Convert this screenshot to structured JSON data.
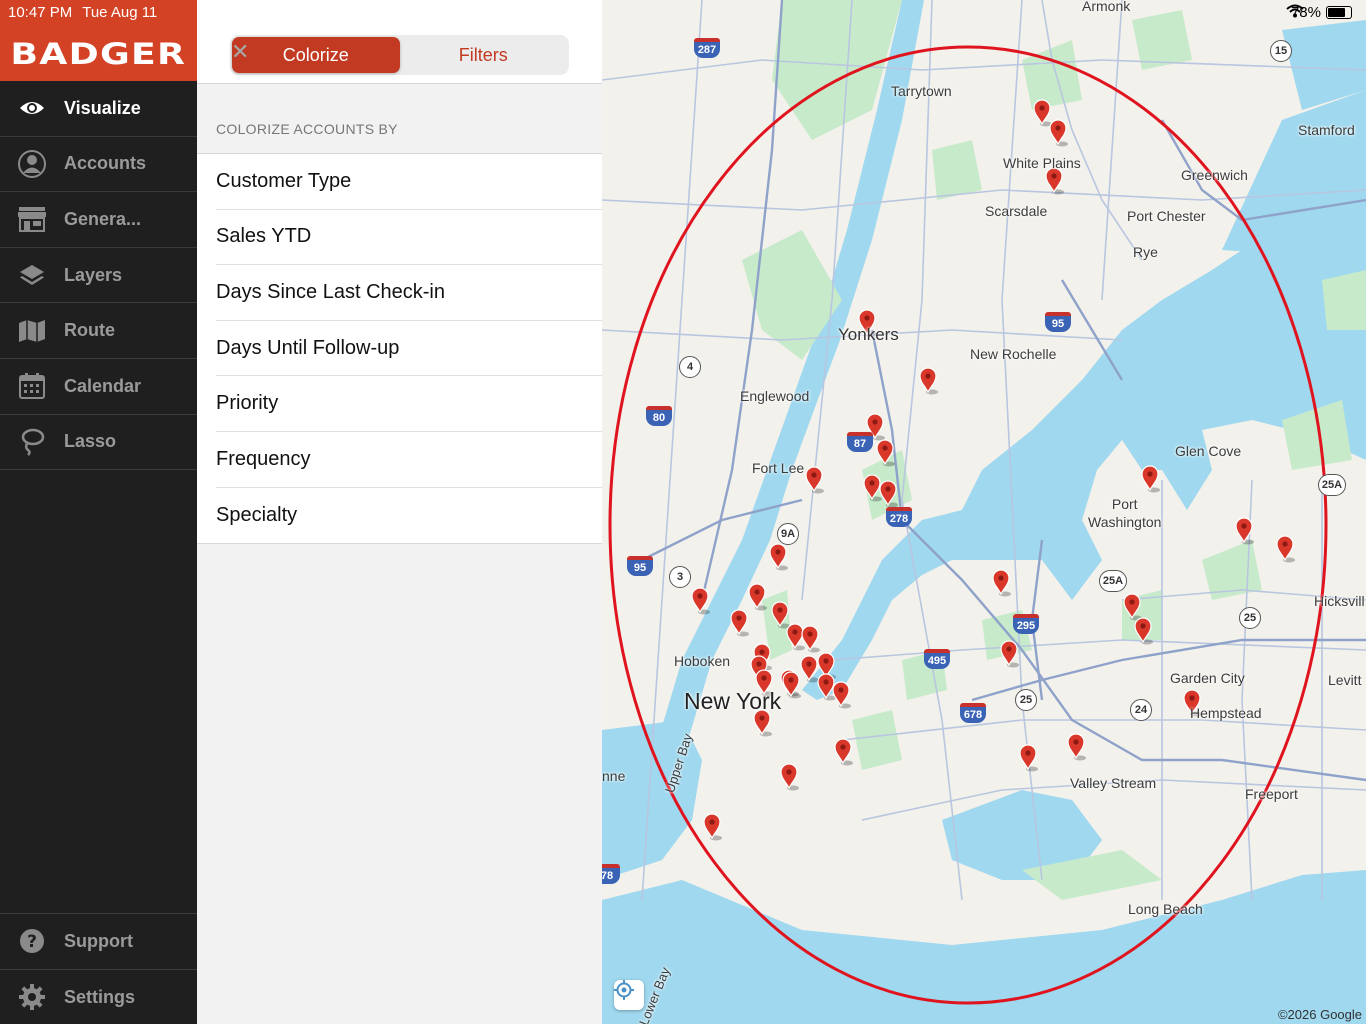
{
  "status": {
    "time": "10:47 PM",
    "date": "Tue Aug 11",
    "battery": "78%",
    "battery_level": 0.78
  },
  "brand": {
    "name": "BADGER",
    "color": "#d44226"
  },
  "sidebar": {
    "items": [
      {
        "label": "Visualize",
        "icon": "eye-icon",
        "active": true
      },
      {
        "label": "Accounts",
        "icon": "person-icon"
      },
      {
        "label": "Genera...",
        "icon": "storefront-icon"
      },
      {
        "label": "Layers",
        "icon": "layers-icon"
      },
      {
        "label": "Route",
        "icon": "map-icon"
      },
      {
        "label": "Calendar",
        "icon": "calendar-icon"
      },
      {
        "label": "Lasso",
        "icon": "lasso-icon"
      }
    ],
    "bottom_items": [
      {
        "label": "Support",
        "icon": "question-icon"
      },
      {
        "label": "Settings",
        "icon": "gear-icon"
      }
    ]
  },
  "panel": {
    "close_icon": "close-icon",
    "tabs": [
      {
        "label": "Colorize",
        "active": true
      },
      {
        "label": "Filters",
        "active": false
      }
    ],
    "section_title": "COLORIZE ACCOUNTS BY",
    "options": [
      "Customer Type",
      "Sales YTD",
      "Days Since Last Check-in",
      "Days Until Follow-up",
      "Priority",
      "Frequency",
      "Specialty"
    ]
  },
  "map": {
    "places": {
      "armonk": "Armonk",
      "tarrytown": "Tarrytown",
      "stamford": "Stamford",
      "white_plains": "White Plains",
      "greenwich": "Greenwich",
      "scarsdale": "Scarsdale",
      "port_chester": "Port Chester",
      "rye": "Rye",
      "yonkers": "Yonkers",
      "new_rochelle": "New Rochelle",
      "englewood": "Englewood",
      "glen_cove": "Glen Cove",
      "fort_lee": "Fort Lee",
      "port_washington": "Port\nWashington",
      "hicksville": "Hicksvill",
      "hoboken": "Hoboken",
      "garden_city": "Garden City",
      "new_york": "New York",
      "hempstead": "Hempstead",
      "levittown": "Levitt",
      "valley_stream": "Valley Stream",
      "freeport": "Freeport",
      "long_beach": "Long Beach",
      "upper_bay": "Upper Bay",
      "lower_bay": "Lower Bay",
      "inne": "nne"
    },
    "route_shields": {
      "r287": "287",
      "r15": "15",
      "r95a": "95",
      "r4": "4",
      "r80": "80",
      "r87": "87",
      "r278": "278",
      "r9a": "9A",
      "r95b": "95",
      "r3": "3",
      "r25a": "25A",
      "r25a2": "25A",
      "r295": "295",
      "r25": "25",
      "r495": "495",
      "r25b": "25",
      "r678": "678",
      "r24": "24",
      "r78": "78"
    },
    "copyright": "©2026 Google",
    "pin_color": "#d9372a",
    "lasso_color": "#e0141e",
    "water_color": "#9fd8ef",
    "park_color": "#c7eacb",
    "locate_icon": "locate-icon"
  }
}
